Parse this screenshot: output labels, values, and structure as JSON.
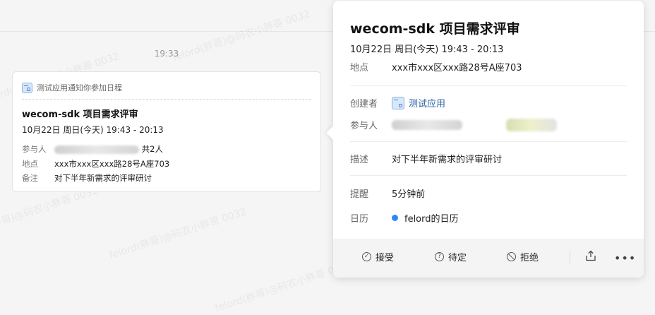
{
  "chat": {
    "time_separator": "19:33",
    "watermark": "felord(胖哥)@码农小胖哥 0032"
  },
  "card": {
    "header": "测试应用通知你参加日程",
    "title": "wecom-sdk 项目需求评审",
    "time": "10月22日 周日(今天) 19:43 - 20:13",
    "participants_label": "参与人",
    "participants_value": "共2人",
    "location_label": "地点",
    "location_value": "xxx市xxx区xxx路28号A座703",
    "note_label": "备注",
    "note_value": "对下半年新需求的评审研讨"
  },
  "popup": {
    "title": "wecom-sdk 项目需求评审",
    "time": "10月22日 周日(今天) 19:43 - 20:13",
    "location_label": "地点",
    "location_value": "xxx市xxx区xxx路28号A座703",
    "creator_label": "创建者",
    "creator_value": "测试应用",
    "participants_label": "参与人",
    "description_label": "描述",
    "description_value": "对下半年新需求的评审研讨",
    "reminder_label": "提醒",
    "reminder_value": "5分钟前",
    "calendar_label": "日历",
    "calendar_value": "felord的日历",
    "calendar_color": "#2f86f6",
    "actions": {
      "accept": "接受",
      "tentative": "待定",
      "decline": "拒绝"
    }
  }
}
